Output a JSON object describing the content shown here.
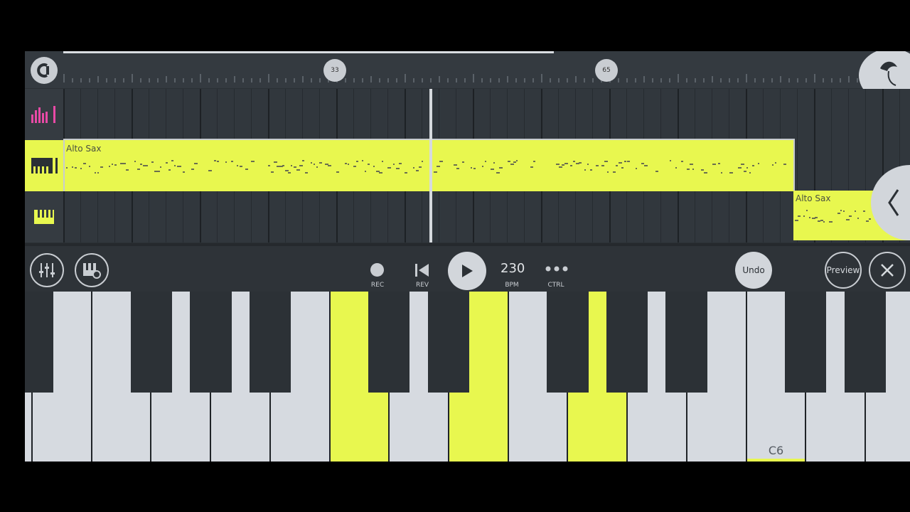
{
  "ruler": {
    "markers": [
      "33",
      "65"
    ]
  },
  "tracks": [
    {
      "kind": "drums",
      "clips": []
    },
    {
      "kind": "piano",
      "clips": [
        {
          "label": "Alto Sax"
        },
        {
          "label": ""
        }
      ]
    },
    {
      "kind": "piano",
      "clips": [
        {
          "label": "Alto Sax"
        }
      ]
    }
  ],
  "transport": {
    "rec_label": "REC",
    "rev_label": "REV",
    "bpm_value": "230",
    "bpm_label": "BPM",
    "ctrl_label": "CTRL",
    "undo_label": "Undo",
    "preview_label": "Preview"
  },
  "keyboard": {
    "c6_label": "C6"
  },
  "colors": {
    "accent": "#e8f74f",
    "background": "#2b3035",
    "drums_icon": "#e84aa6"
  },
  "icons": [
    "loop-icon",
    "drums-icon",
    "piano-icon",
    "mixer-icon",
    "piano-settings-icon",
    "record-icon",
    "rewind-icon",
    "play-icon",
    "more-icon",
    "close-icon",
    "fl-fruit-icon",
    "collapse-chevron-icon"
  ]
}
